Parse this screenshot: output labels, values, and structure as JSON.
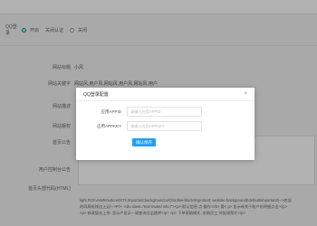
{
  "page": {
    "qq_login_label": "QQ登录",
    "qq_options": [
      "开启",
      "关闭认证",
      "关闭"
    ],
    "fields": [
      {
        "label": "网站标题",
        "value": "小风"
      },
      {
        "label": "网站关键字",
        "value": "网站风,用户风,网站风,用户风,网站风,用户"
      },
      {
        "label": "网站描述",
        "value": ""
      },
      {
        "label": "网站版权",
        "value": ""
      },
      {
        "label": "首页公告",
        "value": ""
      },
      {
        "label": "用户控制台公告",
        "value": ""
      },
      {
        "label": "首页头部代码(HTML)",
        "value": ""
      }
    ],
    "code_lines": [
      "light.RG!!vnWtn0u0c!eSnTl!.!mportant;background:url(!/online-block!important; website-background{!default!important!}-->底部",
      "的四周框线边上运!-->P/>; <div class=\"text muted info;!\"><p> 默认信息 点 操作:</b> 要< p> 显示有关于账户的明细点击:</p>",
      "<p> 修改值去上传: 显示户显示一键查询点击跳转</p> <p> 下单帮助模式, 求助员工 时处理帮忙</p>"
    ]
  },
  "modal": {
    "title": "QQ登录配置",
    "close_symbol": "×",
    "appid_label": "应用APPID",
    "appid_placeholder": "请输入应用APPID",
    "appkey_label": "应用APPKEY",
    "appkey_placeholder": "请输入应用APPKEY",
    "save_label": "确认保存"
  },
  "colors": {
    "accent": "#1e9fff",
    "radio": "#009688"
  }
}
